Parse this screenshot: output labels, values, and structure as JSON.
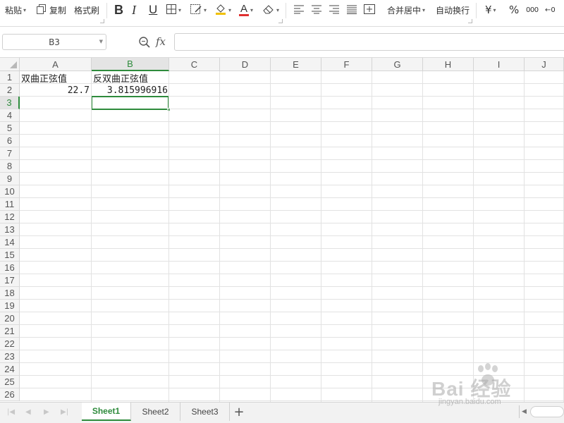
{
  "toolbar": {
    "paste_label": "粘贴",
    "copy_label": "复制",
    "format_painter_label": "格式刷",
    "bold_label": "B",
    "italic_label": "I",
    "underline_label": "U",
    "font_color_label": "A",
    "merge_center_label": "合并居中",
    "wrap_text_label": "自动换行",
    "currency_label": "¥",
    "percent_label": "%",
    "thousands_label": "000",
    "decimal_label": "←0",
    "accent_color": "#2e8b3c",
    "font_color_bar": "#e03030",
    "fill_color_bar": "#f0c000"
  },
  "formula_bar": {
    "name_box": "B3",
    "fx_label": "fx",
    "formula": ""
  },
  "grid": {
    "columns": [
      "A",
      "B",
      "C",
      "D",
      "E",
      "F",
      "G",
      "H",
      "I",
      "J"
    ],
    "rows": [
      "1",
      "2",
      "3",
      "4",
      "5",
      "6",
      "7",
      "8",
      "9",
      "10",
      "11",
      "12",
      "13",
      "14",
      "15",
      "16",
      "17",
      "18",
      "19",
      "20",
      "21",
      "22",
      "23",
      "24",
      "25",
      "26"
    ],
    "selected_cell": "B3",
    "cells": {
      "A1": "双曲正弦值",
      "B1": "反双曲正弦值",
      "A2": "22.7",
      "B2": "3.815996916"
    }
  },
  "sheets": {
    "tabs": [
      "Sheet1",
      "Sheet2",
      "Sheet3"
    ],
    "active": "Sheet1",
    "add_label": "+"
  },
  "watermark": {
    "brand": "Bai 经验",
    "url": "jingyan.baidu.com"
  }
}
